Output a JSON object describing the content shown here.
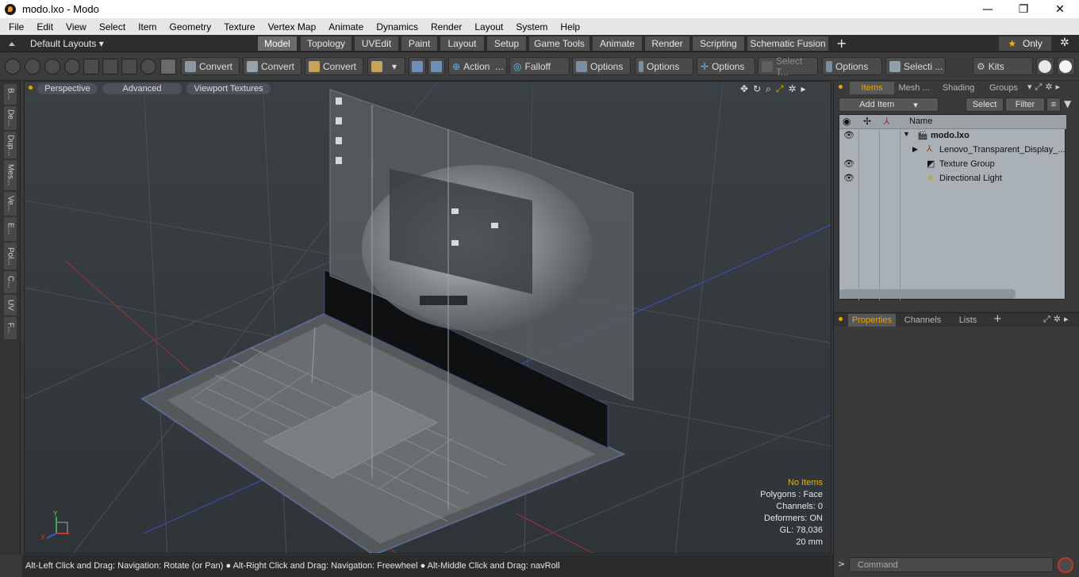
{
  "window": {
    "title": "modo.lxo - Modo",
    "minimize": "—",
    "restore": "❐",
    "close": "✕"
  },
  "menu": [
    "File",
    "Edit",
    "View",
    "Select",
    "Item",
    "Geometry",
    "Texture",
    "Vertex Map",
    "Animate",
    "Dynamics",
    "Render",
    "Layout",
    "System",
    "Help"
  ],
  "layouts": {
    "dropdown": "Default Layouts",
    "tabs": [
      "Model",
      "Topology",
      "UVEdit",
      "Paint",
      "Layout",
      "Setup",
      "Game Tools",
      "Animate",
      "Render",
      "Scripting",
      "Schematic Fusion"
    ],
    "active": "Model",
    "add": "+",
    "only": "Only"
  },
  "toolbar": {
    "convert1": "Convert",
    "convert2": "Convert",
    "convert3": "Convert",
    "action": "Action",
    "falloff": "Falloff",
    "options1": "Options",
    "options2": "Options",
    "options3": "Options",
    "options4": "Options",
    "select_t": "Select T...",
    "selecti": "Selecti ...",
    "kits": "Kits"
  },
  "left_tabs": [
    "B...",
    "De...",
    "Dup...",
    "Mes...",
    "Ve...",
    "E...",
    "Pol...",
    "C...",
    "UV",
    "F..."
  ],
  "viewport": {
    "tabs": [
      "Perspective",
      "Advanced",
      "Viewport Textures"
    ],
    "info": {
      "no_items": "No Items",
      "polygons": "Polygons : Face",
      "channels": "Channels: 0",
      "deformers": "Deformers: ON",
      "gl": "GL: 78,036",
      "scale": "20 mm"
    },
    "axes": {
      "y": "Y",
      "x": "X"
    }
  },
  "status": "Alt-Left Click and Drag: Navigation: Rotate (or Pan) ● Alt-Right Click and Drag: Navigation: Freewheel ● Alt-Middle Click and Drag: navRoll",
  "items_panel": {
    "tabs": [
      "Items",
      "Mesh ...",
      "Shading",
      "Groups"
    ],
    "active": "Items",
    "add_item": "Add Item",
    "select": "Select",
    "filter": "Filter",
    "column_name": "Name",
    "rows": [
      "modo.lxo",
      "Lenovo_Transparent_Display_...",
      "Texture Group",
      "Directional Light"
    ]
  },
  "props_panel": {
    "tabs": [
      "Properties",
      "Channels",
      "Lists"
    ],
    "active": "Properties",
    "add": "+"
  },
  "command": {
    "prompt": ">",
    "placeholder": "Command"
  }
}
